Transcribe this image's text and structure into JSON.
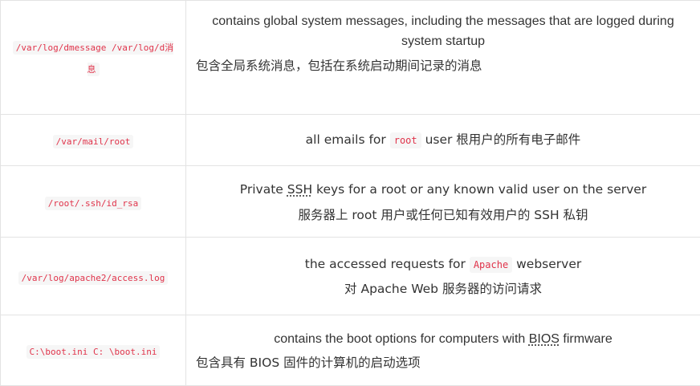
{
  "rows": [
    {
      "path": "/var/log/dmessage /var/log/d消息",
      "en": "contains global system messages, including the messages that are logged during system startup",
      "cn": "包含全局系统消息，包括在系统启动期间记录的消息"
    },
    {
      "path": "/var/mail/root",
      "en_pre": "all emails for",
      "en_code": "root",
      "en_post": "user 根用户的所有电子邮件"
    },
    {
      "path": "/root/.ssh/id_rsa",
      "en_pre": "Private",
      "en_abbr": "SSH",
      "en_post": "keys for a root or any known valid user on the server",
      "cn": "服务器上 root 用户或任何已知有效用户的 SSH 私钥"
    },
    {
      "path": "/var/log/apache2/access.log",
      "en_pre": "the accessed requests for",
      "en_code": "Apache",
      "en_post": "webserver",
      "cn": "对 Apache Web 服务器的访问请求"
    },
    {
      "path": "C:\\boot.ini C: \\boot.ini",
      "en_pre": "contains the boot options for computers with",
      "en_abbr": "BIOS",
      "en_post": "firmware",
      "cn": "包含具有 BIOS 固件的计算机的启动选项"
    }
  ]
}
